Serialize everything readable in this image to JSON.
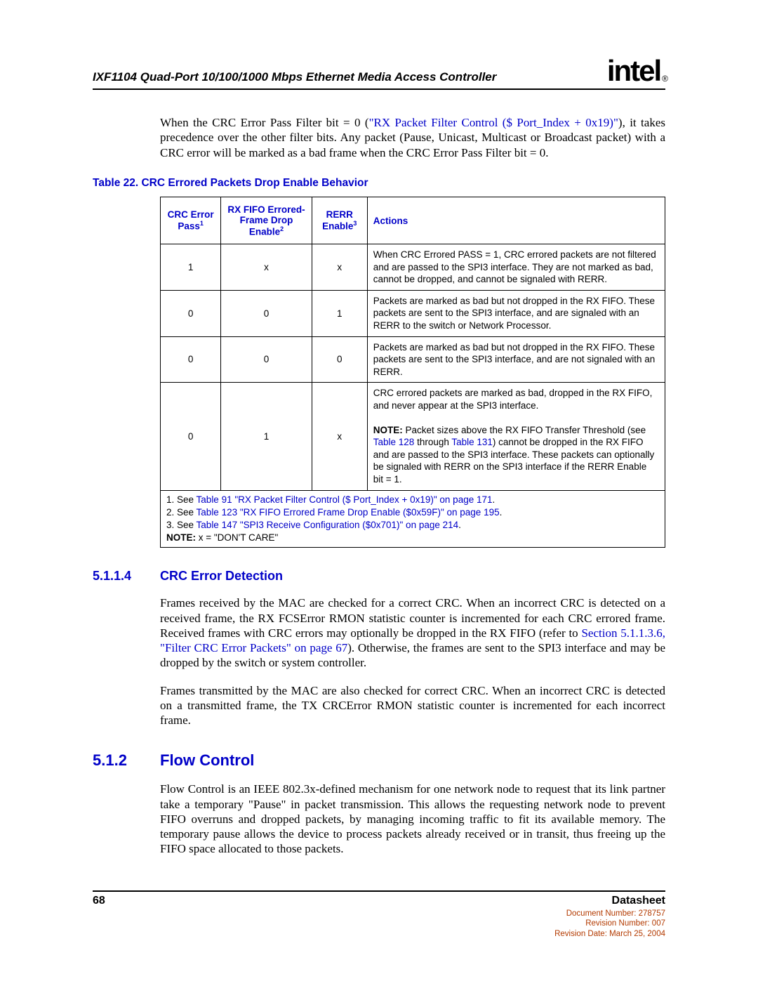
{
  "header": {
    "title": "IXF1104 Quad-Port 10/100/1000 Mbps Ethernet Media Access Controller",
    "logo_text": "intel",
    "logo_reg": "®"
  },
  "intro": {
    "p1_a": "When the CRC Error Pass Filter bit = 0 (",
    "p1_link": "\"RX Packet Filter Control ($ Port_Index + 0x19)\"",
    "p1_b": "), it takes precedence over the other filter bits. Any packet (Pause, Unicast, Multicast or Broadcast packet) with a CRC error will be marked as a bad frame when the CRC Error Pass Filter bit = 0."
  },
  "table": {
    "caption": "Table 22. CRC Errored Packets Drop Enable Behavior",
    "headers": {
      "h1": "CRC Error Pass",
      "h1_sup": "1",
      "h2": "RX FIFO Errored-Frame Drop Enable",
      "h2_sup": "2",
      "h3": "RERR Enable",
      "h3_sup": "3",
      "h4": "Actions"
    },
    "rows": [
      {
        "c1": "1",
        "c2": "x",
        "c3": "x",
        "action": "When CRC Errored PASS = 1, CRC errored packets are not filtered and are passed to the SPI3 interface. They are not marked as bad, cannot be dropped, and cannot be signaled with RERR."
      },
      {
        "c1": "0",
        "c2": "0",
        "c3": "1",
        "action": "Packets are marked as bad but not dropped in the RX FIFO. These packets are sent to the SPI3 interface, and are signaled with an RERR to the switch or Network Processor."
      },
      {
        "c1": "0",
        "c2": "0",
        "c3": "0",
        "action": "Packets are marked as bad but not dropped in the RX FIFO. These packets are sent to the SPI3 interface, and are not signaled with an RERR."
      },
      {
        "c1": "0",
        "c2": "1",
        "c3": "x",
        "action_a": "CRC errored packets are marked as bad, dropped in the RX FIFO, and never appear at the SPI3 interface.",
        "note_label": "NOTE:",
        "note_a": "Packet sizes above the RX FIFO Transfer Threshold (see ",
        "note_link1": "Table 128",
        "note_mid": " through ",
        "note_link2": "Table 131",
        "note_b": ") cannot be dropped in the RX FIFO and are passed to the SPI3 interface. These packets can optionally be signaled with RERR on the SPI3 interface if the RERR Enable bit = 1."
      }
    ],
    "footnotes": {
      "f1a": "1. See ",
      "f1link": "Table 91 \"RX Packet Filter Control ($ Port_Index + 0x19)\" on page 171",
      "f1b": ".",
      "f2a": "2. See ",
      "f2link": "Table 123 \"RX FIFO Errored Frame Drop Enable ($0x59F)\" on page 195",
      "f2b": ".",
      "f3a": "3. See ",
      "f3link": "Table 147 \"SPI3 Receive Configuration ($0x701)\" on page 214",
      "f3b": ".",
      "note_label": "NOTE:",
      "note_text": "  x = \"DON'T CARE\""
    }
  },
  "sec_5_1_1_4": {
    "num": "5.1.1.4",
    "title": "CRC Error Detection",
    "p1a": "Frames received by the MAC are checked for a correct CRC. When an incorrect CRC is detected on a received frame, the RX FCSError RMON statistic counter is incremented for each CRC errored frame. Received frames with CRC errors may optionally be dropped in the RX FIFO (refer to ",
    "p1link": "Section 5.1.1.3.6, \"Filter CRC Error Packets\" on page 67",
    "p1b": "). Otherwise, the frames are sent to the SPI3 interface and may be dropped by the switch or system controller.",
    "p2": "Frames transmitted by the MAC are also checked for correct CRC. When an incorrect CRC is detected on a transmitted frame, the TX CRCError RMON statistic counter is incremented for each incorrect frame."
  },
  "sec_5_1_2": {
    "num": "5.1.2",
    "title": "Flow Control",
    "p1": "Flow Control is an IEEE 802.3x-defined mechanism for one network node to request that its link partner take a temporary \"Pause\" in packet transmission. This allows the requesting network node to prevent FIFO overruns and dropped packets, by managing incoming traffic to fit its available memory. The temporary pause allows the device to process packets already received or in transit, thus freeing up the FIFO space allocated to those packets."
  },
  "footer": {
    "page": "68",
    "datasheet": "Datasheet",
    "doc_num": "Document Number: 278757",
    "rev_num": "Revision Number: 007",
    "rev_date": "Revision Date: March 25, 2004"
  }
}
